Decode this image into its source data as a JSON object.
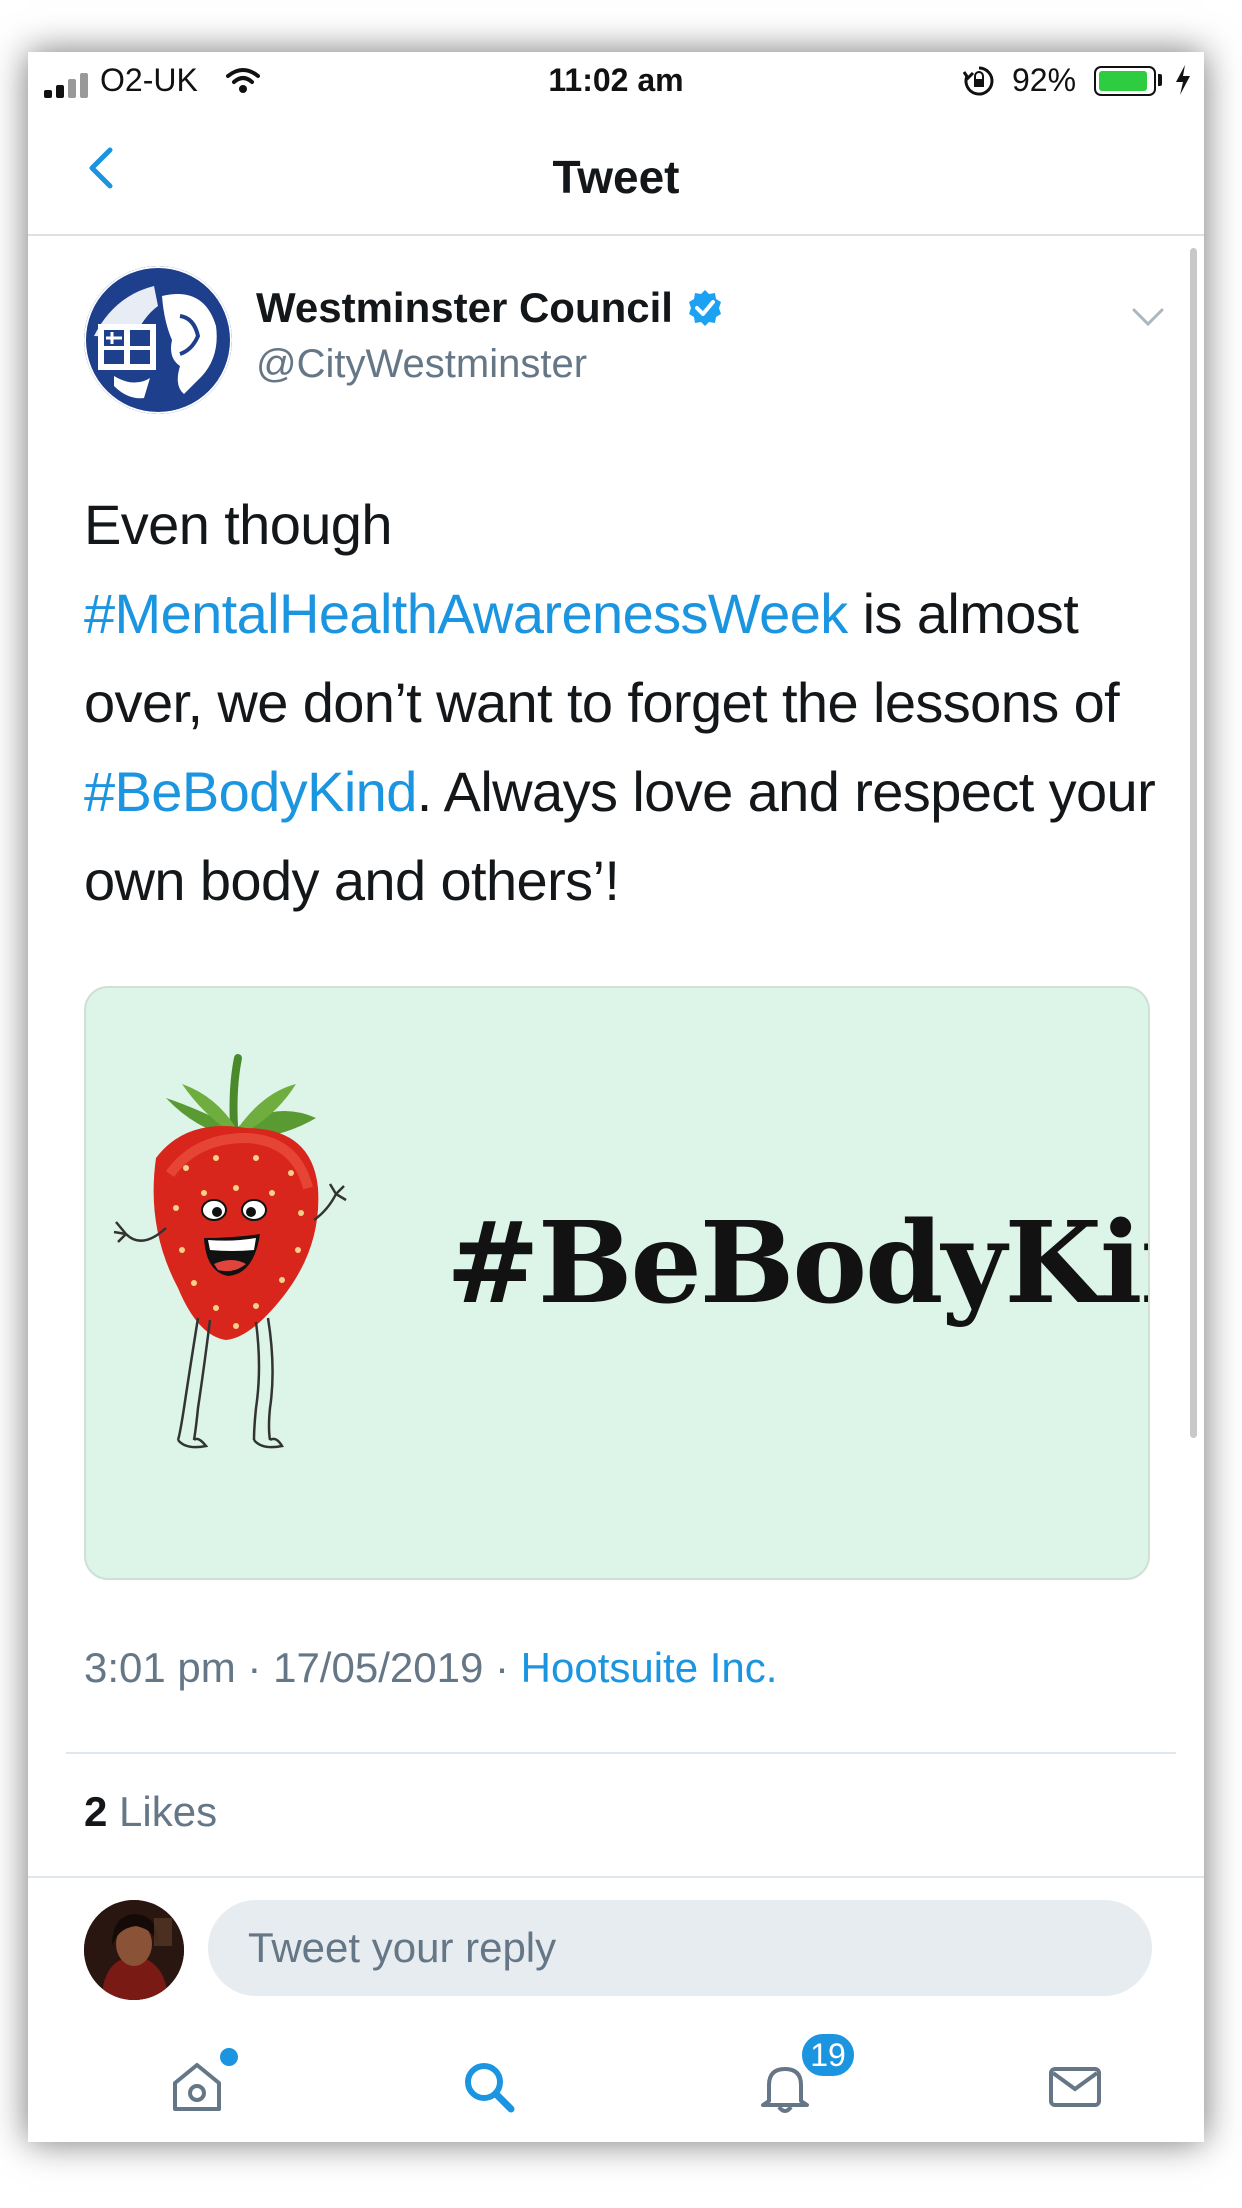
{
  "status_bar": {
    "carrier": "O2-UK",
    "time": "11:02 am",
    "battery_percent": "92%",
    "battery_level": 0.92,
    "icons": [
      "signal-icon",
      "wifi-icon",
      "orientation-lock-icon",
      "battery-icon",
      "charging-bolt-icon"
    ]
  },
  "header": {
    "title": "Tweet",
    "back_icon": "chevron-left-icon"
  },
  "tweet": {
    "author": {
      "name": "Westminster Council",
      "handle": "@CityWestminster",
      "verified": true
    },
    "text_parts": {
      "p1": "Even though ",
      "hashtag1": "#MentalHealthAwarenessWeek",
      "p2": " is almost over, we don’t want to forget the lessons of ",
      "hashtag2": "#BeBodyKind",
      "p3": ". Always love and respect your own body and others’!"
    },
    "media": {
      "image_text": "#BeBodyKind",
      "background_color": "#dcf5e8"
    },
    "meta": {
      "time": "3:01 pm",
      "separator": " · ",
      "date": "17/05/2019",
      "source": "Hootsuite Inc."
    },
    "likes": {
      "count": "2",
      "label": " Likes"
    }
  },
  "reply": {
    "placeholder": "Tweet your reply"
  },
  "tab_bar": {
    "tabs": [
      {
        "icon": "home-icon",
        "active": false,
        "has_dot": true
      },
      {
        "icon": "search-icon",
        "active": true
      },
      {
        "icon": "notifications-icon",
        "active": false,
        "badge": "19"
      },
      {
        "icon": "messages-icon",
        "active": false
      }
    ]
  },
  "colors": {
    "accent": "#1b95e0",
    "text_primary": "#14171a",
    "text_secondary": "#657786",
    "verified": "#1da1f2"
  }
}
